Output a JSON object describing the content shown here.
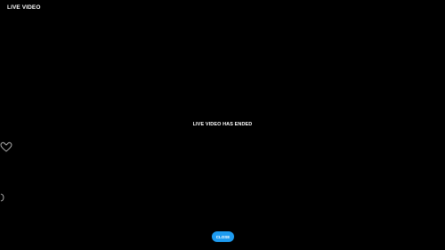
{
  "header": {
    "title": "LIVE VIDEO"
  },
  "main": {
    "message": "LIVE VIDEO HAS ENDED"
  },
  "footer": {
    "close_label": "CLOSE"
  },
  "icons": {
    "left_heart": "heart-icon",
    "left_arc": "reaction-arc-icon"
  },
  "colors": {
    "background": "#000000",
    "text": "#ffffff",
    "accent": "#1d9bf0"
  }
}
